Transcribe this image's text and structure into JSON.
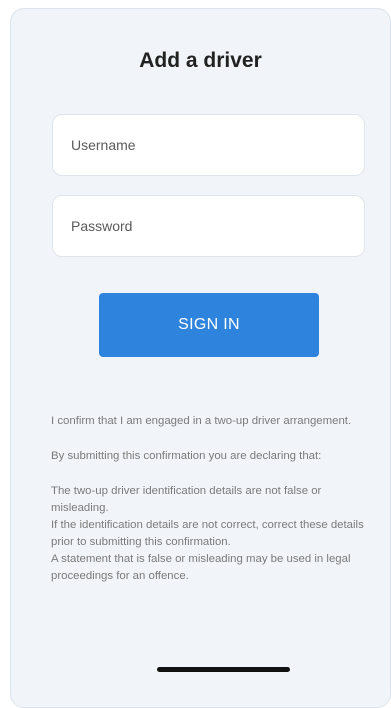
{
  "form": {
    "title": "Add a driver",
    "username_placeholder": "Username",
    "password_placeholder": "Password",
    "signin_label": "SIGN IN"
  },
  "disclaimer": {
    "confirm": "I confirm that I am engaged in a two-up driver arrangement.",
    "declaring": "By submitting this confirmation you are declaring that:",
    "points": [
      "The two-up driver identification details are not false or misleading.",
      "If the identification details are not correct, correct these details prior to submitting this confirmation.",
      "A statement that is false or misleading may be used in legal proceedings for an offence."
    ]
  },
  "colors": {
    "card_background": "#f1f5fa",
    "primary_button": "#2e84dc",
    "text_muted": "#7a7a7a"
  }
}
